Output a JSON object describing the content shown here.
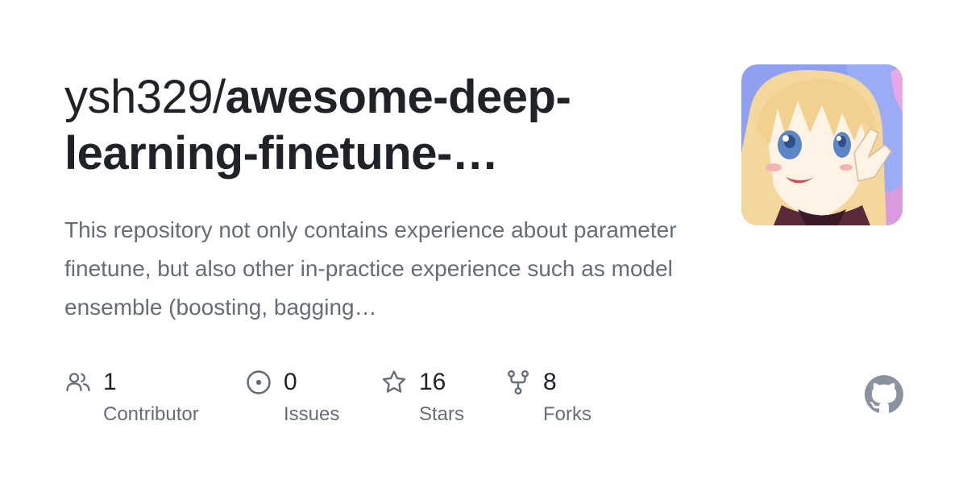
{
  "repo": {
    "owner": "ysh329/",
    "name": "awesome-deep-learning-finetune-…",
    "description": "This repository not only contains experience about parameter finetune, but also other in-practice experience such as model ensemble (boosting, bagging…"
  },
  "stats": {
    "contributors": {
      "value": "1",
      "label": "Contributor",
      "icon": "people-icon"
    },
    "issues": {
      "value": "0",
      "label": "Issues",
      "icon": "issue-opened-icon"
    },
    "stars": {
      "value": "16",
      "label": "Stars",
      "icon": "star-icon"
    },
    "forks": {
      "value": "8",
      "label": "Forks",
      "icon": "repo-forked-icon"
    }
  },
  "colors": {
    "title": "#1f2328",
    "muted": "#656d76",
    "github_mark": "#8b949e",
    "avatar_bg": "#8fa0f0"
  }
}
